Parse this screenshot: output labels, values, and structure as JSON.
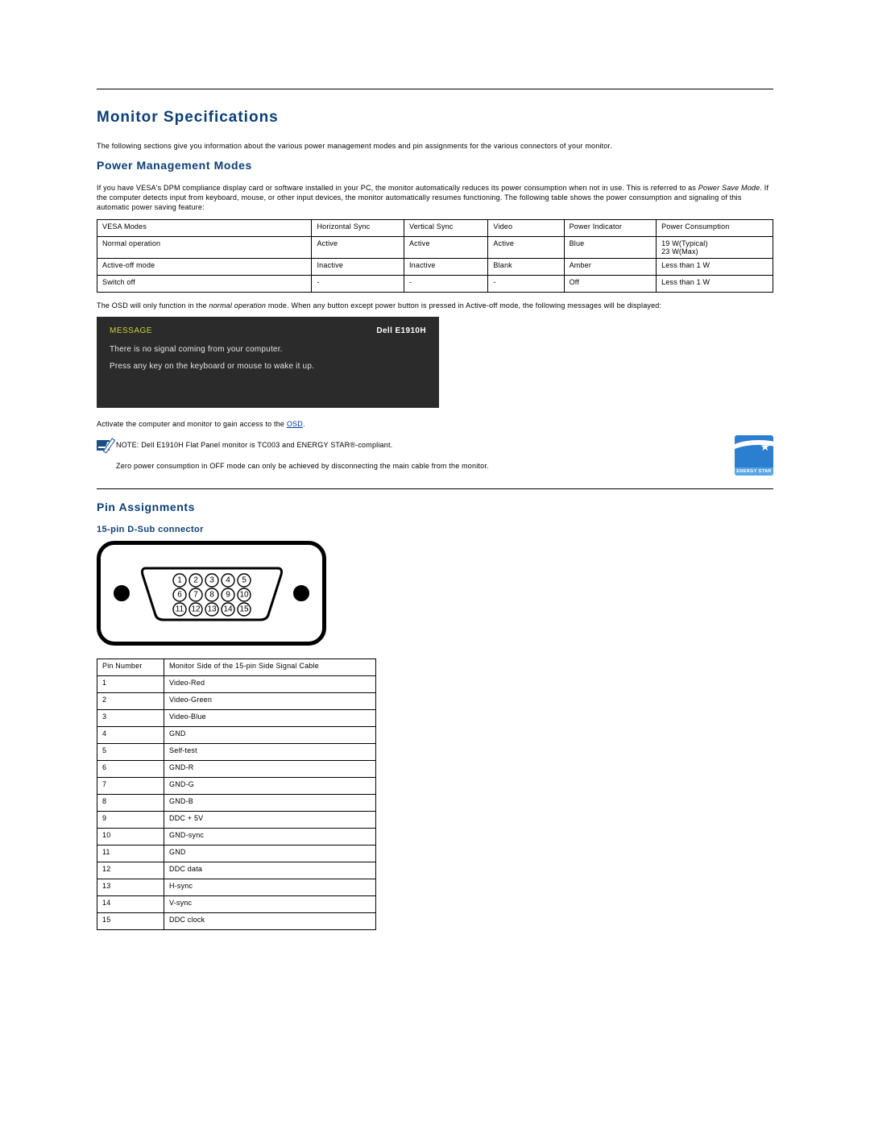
{
  "title": "Monitor Specifications",
  "intro": "The following sections give you information about the various power management modes and pin assignments for the various connectors of your monitor.",
  "power": {
    "heading": "Power Management Modes",
    "para_before": "If you have VESA's DPM compliance display card or software installed in your PC, the monitor automatically reduces its power consumption when not in use. This is referred to as ",
    "para_italic": "Power Save Mode",
    "para_after": ". If the computer detects input from keyboard, mouse, or other input devices, the monitor automatically resumes functioning. The following table shows the power consumption and signaling of this automatic power saving feature:",
    "columns": [
      "VESA Modes",
      "Horizontal Sync",
      "Vertical Sync",
      "Video",
      "Power Indicator",
      "Power Consumption"
    ],
    "rows": [
      [
        "Normal operation",
        "Active",
        "Active",
        "Active",
        "Blue",
        "19 W(Typical)\n23 W(Max)"
      ],
      [
        "Active-off mode",
        "Inactive",
        "Inactive",
        "Blank",
        "Amber",
        "Less than 1 W"
      ],
      [
        "Switch off",
        "-",
        "-",
        "-",
        "Off",
        "Less than 1 W"
      ]
    ],
    "osd_note_before": "The OSD will only function in the ",
    "osd_note_italic": "normal operation",
    "osd_note_after": " mode. When any button except power button is pressed in Active-off mode, the following messages will be displayed:"
  },
  "osd": {
    "message_label": "MESSAGE",
    "model": "Dell E1910H",
    "line1": "There is no signal coming from your computer.",
    "line2": "Press any key on the keyboard or mouse to wake it up."
  },
  "activate": {
    "before": "Activate the computer and monitor to gain access to the ",
    "link": "OSD",
    "after": "."
  },
  "note": {
    "label": "NOTE:",
    "text": " Dell E1910H Flat Panel monitor is TC003 and ENERGY STAR®-compliant."
  },
  "zero_power": "Zero power consumption in OFF mode can only be achieved by disconnecting the main cable from the monitor.",
  "energy_star_label": "ENERGY STAR",
  "pins": {
    "heading": "Pin Assignments",
    "sub": "15-pin D-Sub connector",
    "columns": [
      "Pin Number",
      "Monitor Side of the 15-pin Side Signal Cable"
    ],
    "rows": [
      [
        "1",
        "Video-Red"
      ],
      [
        "2",
        "Video-Green"
      ],
      [
        "3",
        "Video-Blue"
      ],
      [
        "4",
        "GND"
      ],
      [
        "5",
        "Self-test"
      ],
      [
        "6",
        "GND-R"
      ],
      [
        "7",
        "GND-G"
      ],
      [
        "8",
        "GND-B"
      ],
      [
        "9",
        "DDC + 5V"
      ],
      [
        "10",
        "GND-sync"
      ],
      [
        "11",
        "GND"
      ],
      [
        "12",
        "DDC data"
      ],
      [
        "13",
        "H-sync"
      ],
      [
        "14",
        "V-sync"
      ],
      [
        "15",
        "DDC clock"
      ]
    ]
  }
}
